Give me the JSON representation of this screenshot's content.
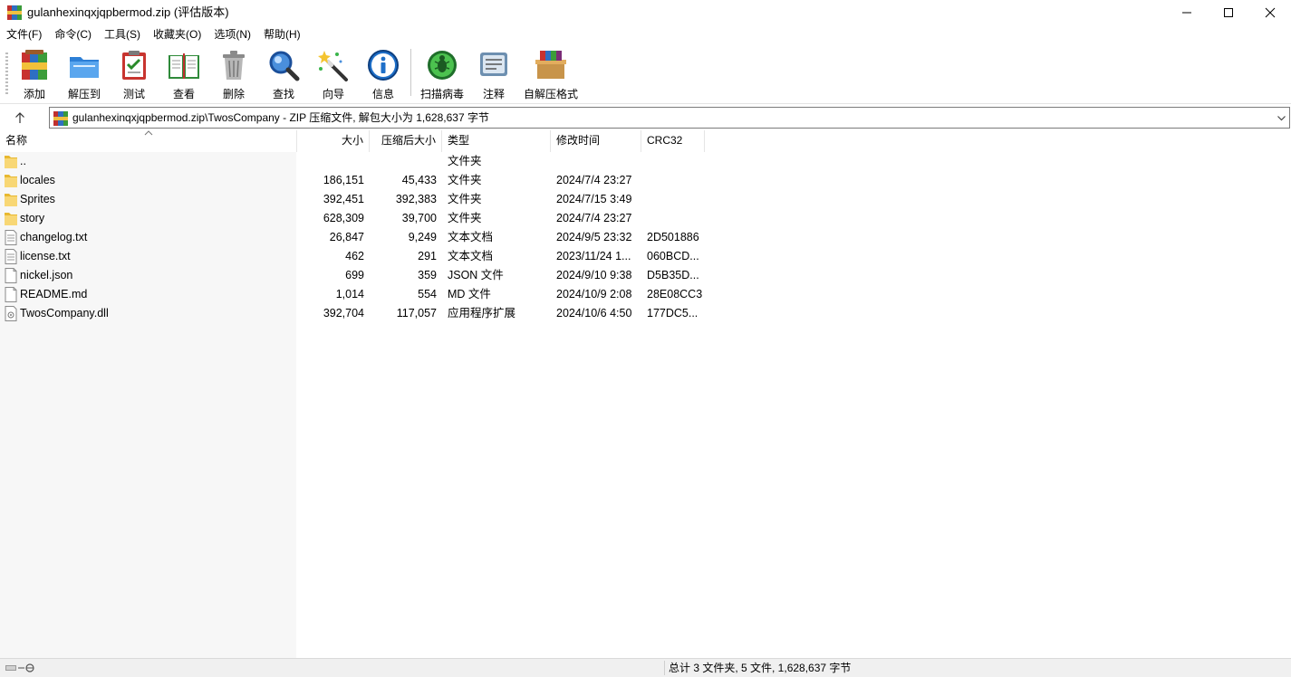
{
  "window": {
    "title": "gulanhexinqxjqpbermod.zip (评估版本)"
  },
  "menu": [
    {
      "label": "文件(F)"
    },
    {
      "label": "命令(C)"
    },
    {
      "label": "工具(S)"
    },
    {
      "label": "收藏夹(O)"
    },
    {
      "label": "选项(N)"
    },
    {
      "label": "帮助(H)"
    }
  ],
  "toolbar": [
    {
      "label": "添加",
      "icon": "add-archive-icon"
    },
    {
      "label": "解压到",
      "icon": "extract-folder-icon"
    },
    {
      "label": "测试",
      "icon": "test-clipboard-icon"
    },
    {
      "label": "查看",
      "icon": "view-book-icon"
    },
    {
      "label": "删除",
      "icon": "trash-icon"
    },
    {
      "label": "查找",
      "icon": "magnifier-icon"
    },
    {
      "label": "向导",
      "icon": "wizard-wand-icon"
    },
    {
      "label": "信息",
      "icon": "info-icon"
    },
    {
      "label": "扫描病毒",
      "icon": "virus-scan-icon"
    },
    {
      "label": "注释",
      "icon": "comment-icon"
    },
    {
      "label": "自解压格式",
      "icon": "sfx-box-icon"
    }
  ],
  "address": {
    "path": "gulanhexinqxjqpbermod.zip\\TwosCompany - ZIP 压缩文件, 解包大小为 1,628,637 字节"
  },
  "columns": {
    "name": "名称",
    "size": "大小",
    "packed": "压缩后大小",
    "type": "类型",
    "mtime": "修改时间",
    "crc": "CRC32"
  },
  "files": [
    {
      "name": "..",
      "size": "",
      "packed": "",
      "type": "文件夹",
      "mtime": "",
      "crc": "",
      "kind": "folder"
    },
    {
      "name": "locales",
      "size": "186,151",
      "packed": "45,433",
      "type": "文件夹",
      "mtime": "2024/7/4 23:27",
      "crc": "",
      "kind": "folder"
    },
    {
      "name": "Sprites",
      "size": "392,451",
      "packed": "392,383",
      "type": "文件夹",
      "mtime": "2024/7/15 3:49",
      "crc": "",
      "kind": "folder"
    },
    {
      "name": "story",
      "size": "628,309",
      "packed": "39,700",
      "type": "文件夹",
      "mtime": "2024/7/4 23:27",
      "crc": "",
      "kind": "folder"
    },
    {
      "name": "changelog.txt",
      "size": "26,847",
      "packed": "9,249",
      "type": "文本文档",
      "mtime": "2024/9/5 23:32",
      "crc": "2D501886",
      "kind": "text"
    },
    {
      "name": "license.txt",
      "size": "462",
      "packed": "291",
      "type": "文本文档",
      "mtime": "2023/11/24 1...",
      "crc": "060BCD...",
      "kind": "text"
    },
    {
      "name": "nickel.json",
      "size": "699",
      "packed": "359",
      "type": "JSON 文件",
      "mtime": "2024/9/10 9:38",
      "crc": "D5B35D...",
      "kind": "file"
    },
    {
      "name": "README.md",
      "size": "1,014",
      "packed": "554",
      "type": "MD 文件",
      "mtime": "2024/10/9 2:08",
      "crc": "28E08CC3",
      "kind": "file"
    },
    {
      "name": "TwosCompany.dll",
      "size": "392,704",
      "packed": "117,057",
      "type": "应用程序扩展",
      "mtime": "2024/10/6 4:50",
      "crc": "177DC5...",
      "kind": "dll"
    }
  ],
  "status": {
    "summary": "总计 3 文件夹, 5 文件, 1,628,637 字节"
  },
  "colors": {
    "folder": "#f8d775",
    "folder_dark": "#e8b830",
    "accent_blue": "#1e6fc8"
  }
}
